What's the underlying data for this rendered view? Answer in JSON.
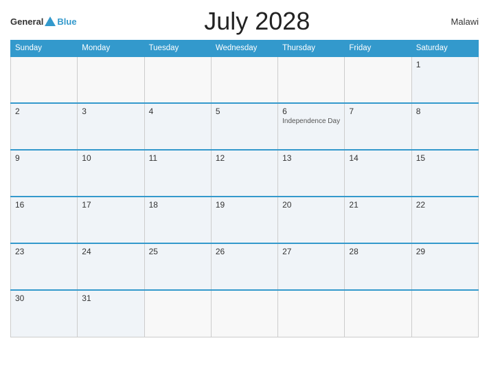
{
  "header": {
    "logo_general": "General",
    "logo_blue": "Blue",
    "title": "July 2028",
    "country": "Malawi"
  },
  "weekdays": [
    "Sunday",
    "Monday",
    "Tuesday",
    "Wednesday",
    "Thursday",
    "Friday",
    "Saturday"
  ],
  "weeks": [
    [
      {
        "day": "",
        "empty": true
      },
      {
        "day": "",
        "empty": true
      },
      {
        "day": "",
        "empty": true
      },
      {
        "day": "",
        "empty": true
      },
      {
        "day": "",
        "empty": true
      },
      {
        "day": "",
        "empty": true
      },
      {
        "day": "1",
        "empty": false,
        "event": ""
      }
    ],
    [
      {
        "day": "2",
        "empty": false,
        "event": ""
      },
      {
        "day": "3",
        "empty": false,
        "event": ""
      },
      {
        "day": "4",
        "empty": false,
        "event": ""
      },
      {
        "day": "5",
        "empty": false,
        "event": ""
      },
      {
        "day": "6",
        "empty": false,
        "event": "Independence Day"
      },
      {
        "day": "7",
        "empty": false,
        "event": ""
      },
      {
        "day": "8",
        "empty": false,
        "event": ""
      }
    ],
    [
      {
        "day": "9",
        "empty": false,
        "event": ""
      },
      {
        "day": "10",
        "empty": false,
        "event": ""
      },
      {
        "day": "11",
        "empty": false,
        "event": ""
      },
      {
        "day": "12",
        "empty": false,
        "event": ""
      },
      {
        "day": "13",
        "empty": false,
        "event": ""
      },
      {
        "day": "14",
        "empty": false,
        "event": ""
      },
      {
        "day": "15",
        "empty": false,
        "event": ""
      }
    ],
    [
      {
        "day": "16",
        "empty": false,
        "event": ""
      },
      {
        "day": "17",
        "empty": false,
        "event": ""
      },
      {
        "day": "18",
        "empty": false,
        "event": ""
      },
      {
        "day": "19",
        "empty": false,
        "event": ""
      },
      {
        "day": "20",
        "empty": false,
        "event": ""
      },
      {
        "day": "21",
        "empty": false,
        "event": ""
      },
      {
        "day": "22",
        "empty": false,
        "event": ""
      }
    ],
    [
      {
        "day": "23",
        "empty": false,
        "event": ""
      },
      {
        "day": "24",
        "empty": false,
        "event": ""
      },
      {
        "day": "25",
        "empty": false,
        "event": ""
      },
      {
        "day": "26",
        "empty": false,
        "event": ""
      },
      {
        "day": "27",
        "empty": false,
        "event": ""
      },
      {
        "day": "28",
        "empty": false,
        "event": ""
      },
      {
        "day": "29",
        "empty": false,
        "event": ""
      }
    ],
    [
      {
        "day": "30",
        "empty": false,
        "event": ""
      },
      {
        "day": "31",
        "empty": false,
        "event": ""
      },
      {
        "day": "",
        "empty": true
      },
      {
        "day": "",
        "empty": true
      },
      {
        "day": "",
        "empty": true
      },
      {
        "day": "",
        "empty": true
      },
      {
        "day": "",
        "empty": true
      }
    ]
  ]
}
